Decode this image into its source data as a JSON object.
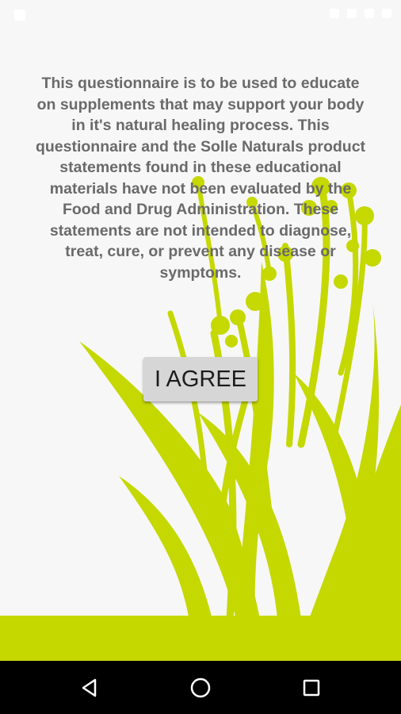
{
  "app": {
    "disclaimer_text": "This questionnaire is to be used to educate on supplements that may support your body in it's natural healing process. This questionnaire and the Solle Naturals product statements found in these educational materials have not been evaluated by the Food and Drug Administration. These statements are not intended to diagnose, treat, cure, or prevent any disease or symptoms.",
    "agree_label": "I AGREE"
  },
  "colors": {
    "background": "#f7f7f7",
    "plant": "#c5d800",
    "text": "#6a6a6a",
    "button": "#d6d6d6",
    "nav_bar": "#000000"
  },
  "icons": {
    "nav_back": "triangle-back-icon",
    "nav_home": "circle-home-icon",
    "nav_recent": "square-recents-icon"
  }
}
